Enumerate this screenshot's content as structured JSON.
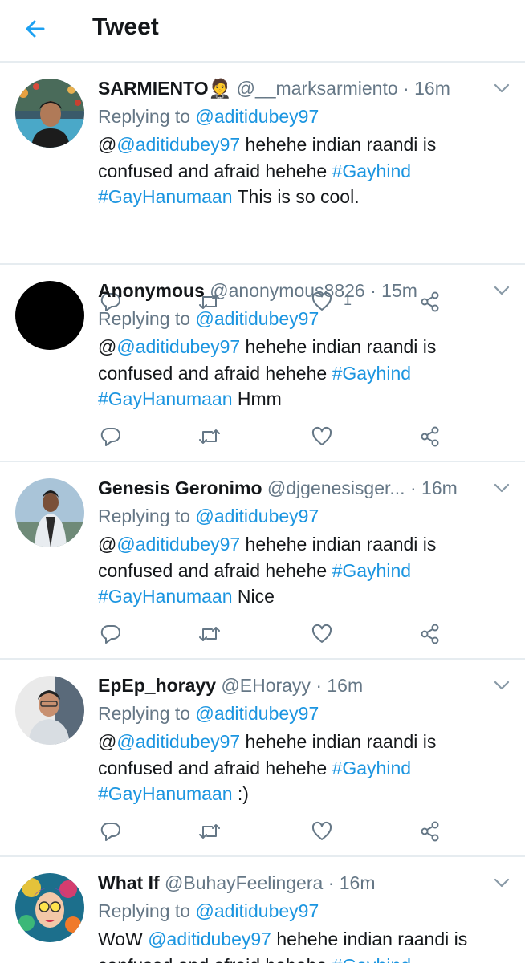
{
  "header": {
    "title": "Tweet"
  },
  "reply_prefix": "Replying to",
  "tweets": [
    {
      "name": "SARMIENTO",
      "name_emoji": "🤵",
      "handle": "@__marksarmiento",
      "separator": "·",
      "time": "16m",
      "replying_to": "@aditidubey97",
      "body_prefix": "@",
      "body_mention": "@aditidubey97",
      "body_text": " hehehe indian raandi is confused and afraid hehehe ",
      "hashtag1": "#Gayhind",
      "hashtag2": "#GayHanumaan",
      "body_suffix": " This is so cool.",
      "like_count": "1"
    },
    {
      "name": "Anonymous",
      "handle": "@anonymous8826",
      "separator": "·",
      "time": "15m",
      "replying_to": "@aditidubey97",
      "body_prefix": "@",
      "body_mention": "@aditidubey97",
      "body_text": " hehehe indian raandi is confused and afraid hehehe ",
      "hashtag1": "#Gayhind",
      "hashtag2": "#GayHanumaan",
      "body_suffix": " Hmm",
      "like_count": ""
    },
    {
      "name": "Genesis Geronimo",
      "handle": "@djgenesisger...",
      "separator": "·",
      "time": "16m",
      "replying_to": "@aditidubey97",
      "body_prefix": "@",
      "body_mention": "@aditidubey97",
      "body_text": " hehehe indian raandi is confused and afraid hehehe ",
      "hashtag1": "#Gayhind",
      "hashtag2": "#GayHanumaan",
      "body_suffix": " Nice",
      "like_count": ""
    },
    {
      "name": "EpEp_horayy",
      "handle": "@EHorayy",
      "separator": "·",
      "time": "16m",
      "replying_to": "@aditidubey97",
      "body_prefix": "@",
      "body_mention": "@aditidubey97",
      "body_text": " hehehe indian raandi is confused and afraid hehehe ",
      "hashtag1": "#Gayhind",
      "hashtag2": "#GayHanumaan",
      "body_suffix": " :)",
      "like_count": ""
    },
    {
      "name": "What If",
      "handle": "@BuhayFeelingera",
      "separator": "·",
      "time": "16m",
      "replying_to": "@aditidubey97",
      "body_prefix": "WoW ",
      "body_mention": "@aditidubey97",
      "body_text": " hehehe indian raandi is confused and afraid hehehe ",
      "hashtag1": "#Gayhind",
      "hashtag2": "",
      "body_suffix": "",
      "like_count": ""
    }
  ],
  "colors": {
    "accent": "#1da1f2",
    "link": "#1b95e0",
    "muted": "#657786",
    "divider": "#e6ecf0"
  },
  "icons": [
    "back-arrow-icon",
    "chevron-down-icon",
    "reply-icon",
    "retweet-icon",
    "heart-icon",
    "share-icon"
  ]
}
